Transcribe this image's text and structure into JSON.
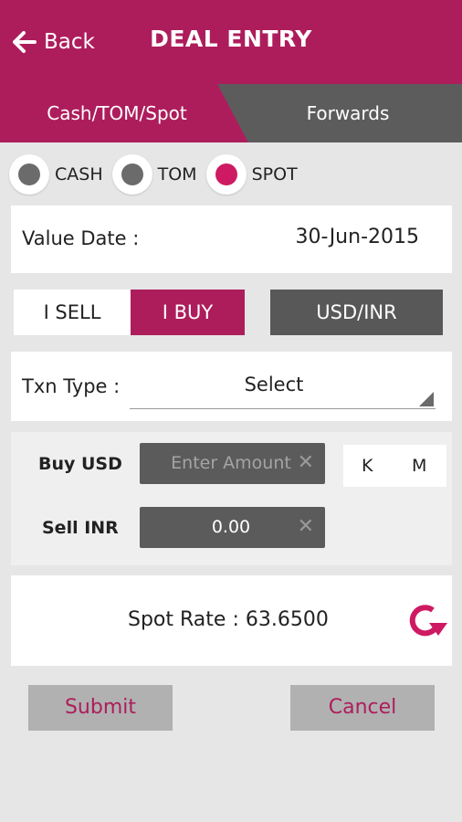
{
  "header": {
    "back_label": "Back",
    "title": "DEAL ENTRY"
  },
  "tabs": [
    {
      "label": "Cash/TOM/Spot",
      "active": true
    },
    {
      "label": "Forwards",
      "active": false
    }
  ],
  "settlement": {
    "options": [
      "CASH",
      "TOM",
      "SPOT"
    ],
    "selected": "SPOT"
  },
  "value_date": {
    "label": "Value Date :",
    "value": "30-Jun-2015"
  },
  "direction": {
    "sell_label": "I SELL",
    "buy_label": "I BUY",
    "selected": "I BUY"
  },
  "currency_pair": "USD/INR",
  "txn_type": {
    "label": "Txn Type :",
    "value": "Select"
  },
  "amounts": {
    "buy_label": "Buy USD",
    "buy_placeholder": "Enter Amount",
    "sell_label": "Sell INR",
    "sell_value": "0.00",
    "clear_symbol": "✕",
    "unit_k": "K",
    "unit_m": "M"
  },
  "rate": {
    "text": "Spot Rate : 63.6500"
  },
  "actions": {
    "submit_label": "Submit",
    "cancel_label": "Cancel"
  },
  "colors": {
    "accent": "#ad1d5c",
    "radio_selected": "#ce1a62",
    "dark_button": "#585858"
  }
}
